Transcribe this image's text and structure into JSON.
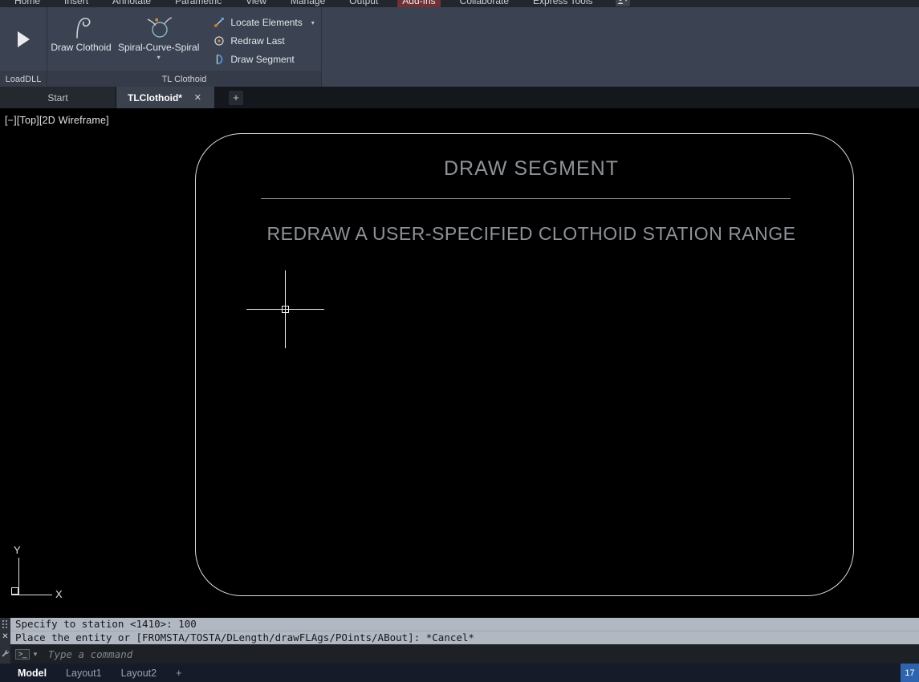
{
  "colors": {
    "ribbon_bg": "#3b4251",
    "active_ribbon_tab_highlight": "#6e3134",
    "canvas_bg": "#000000",
    "command_history_bg": "#b2b8c2",
    "status_accent_blue": "#2e64ad",
    "entity_line": "#dcdcdc",
    "drawing_text": "#8e9297"
  },
  "top_tabs": {
    "items": [
      {
        "label": "Home"
      },
      {
        "label": "Insert"
      },
      {
        "label": "Annotate"
      },
      {
        "label": "Parametric"
      },
      {
        "label": "View"
      },
      {
        "label": "Manage"
      },
      {
        "label": "Output"
      },
      {
        "label": "Add-Ins"
      },
      {
        "label": "Collaborate"
      },
      {
        "label": "Express Tools"
      }
    ],
    "active_label": "Add-Ins"
  },
  "ribbon": {
    "loaddll_panel": {
      "title": "LoadDLL"
    },
    "tl_clothoid_panel": {
      "title": "TL Clothoid",
      "draw_clothoid_label": "Draw Clothoid",
      "spiral_curve_spiral_label": "Spiral-Curve-Spiral",
      "locate_elements_label": "Locate Elements",
      "redraw_last_label": "Redraw Last",
      "draw_segment_label": "Draw Segment"
    }
  },
  "file_tabs": {
    "start_label": "Start",
    "active_label": "TLClothoid*",
    "new_tab_label": "+"
  },
  "viewport": {
    "controls": {
      "minimize": "[−]",
      "view": "[Top]",
      "visual_style": "[2D Wireframe]"
    },
    "ucs": {
      "x": "X",
      "y": "Y"
    }
  },
  "drawing": {
    "title": "DRAW SEGMENT",
    "subtitle": "REDRAW A USER-SPECIFIED CLOTHOID STATION RANGE"
  },
  "command": {
    "history": [
      "Specify to station <1410>: 100",
      "Place the entity or [FROMSTA/TOSTA/DLength/drawFLAgs/POints/ABout]: *Cancel*"
    ],
    "placeholder": "Type a command"
  },
  "status": {
    "model_label": "Model",
    "layout1_label": "Layout1",
    "layout2_label": "Layout2",
    "new_layout_label": "+",
    "right_value": "17"
  }
}
